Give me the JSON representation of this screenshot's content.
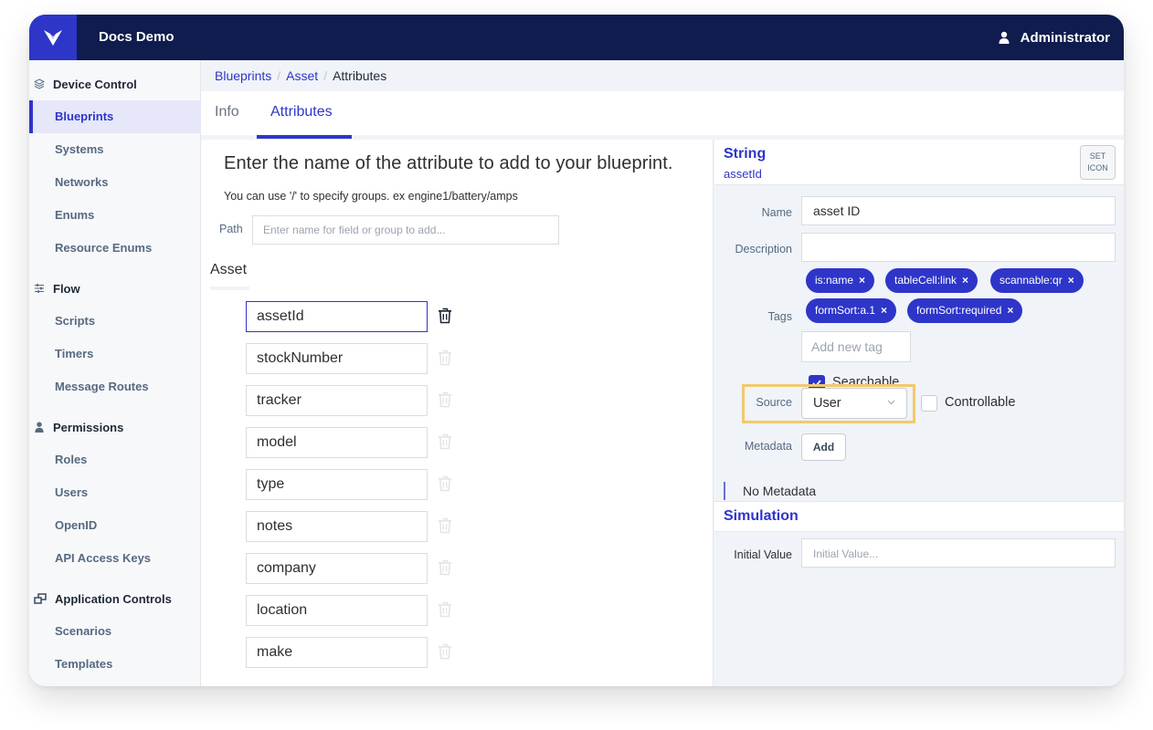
{
  "header": {
    "app_title": "Docs Demo",
    "user_name": "Administrator"
  },
  "sidebar": {
    "sections": [
      {
        "label": "Device Control",
        "icon": "layers-icon",
        "items": [
          {
            "label": "Blueprints",
            "active": true
          },
          {
            "label": "Systems"
          },
          {
            "label": "Networks"
          },
          {
            "label": "Enums"
          },
          {
            "label": "Resource Enums"
          }
        ]
      },
      {
        "label": "Flow",
        "icon": "sliders-icon",
        "items": [
          {
            "label": "Scripts"
          },
          {
            "label": "Timers"
          },
          {
            "label": "Message Routes"
          }
        ]
      },
      {
        "label": "Permissions",
        "icon": "user-icon",
        "items": [
          {
            "label": "Roles"
          },
          {
            "label": "Users"
          },
          {
            "label": "OpenID"
          },
          {
            "label": "API Access Keys"
          }
        ]
      },
      {
        "label": "Application Controls",
        "icon": "windows-icon",
        "items": [
          {
            "label": "Scenarios"
          },
          {
            "label": "Templates"
          }
        ]
      }
    ]
  },
  "breadcrumb": {
    "items": [
      "Blueprints",
      "Asset",
      "Attributes"
    ]
  },
  "tabs": [
    {
      "label": "Info",
      "active": false
    },
    {
      "label": "Attributes",
      "active": true
    }
  ],
  "attributes_pane": {
    "title": "Enter the name of the attribute to add to your blueprint.",
    "subtitle": "You can use '/' to specify groups. ex engine1/battery/amps",
    "path_label": "Path",
    "path_placeholder": "Enter name for field or group to add...",
    "path_value": "",
    "group_name": "Asset",
    "attributes": [
      {
        "value": "assetId",
        "focused": true
      },
      {
        "value": "stockNumber"
      },
      {
        "value": "tracker"
      },
      {
        "value": "model"
      },
      {
        "value": "type"
      },
      {
        "value": "notes"
      },
      {
        "value": "company"
      },
      {
        "value": "location"
      },
      {
        "value": "make"
      }
    ]
  },
  "detail": {
    "type": "String",
    "attribute_key": "assetId",
    "set_icon_label_line1": "SET",
    "set_icon_label_line2": "ICON",
    "name_label": "Name",
    "name_value": "asset ID",
    "description_label": "Description",
    "description_value": "",
    "tags_label": "Tags",
    "tags": [
      "is:name",
      "tableCell:link",
      "scannable:qr",
      "formSort:a.1",
      "formSort:required"
    ],
    "tag_remove_glyph": "×",
    "add_tag_placeholder": "Add new tag",
    "searchable_label": "Searchable",
    "searchable_checked": true,
    "source_label": "Source",
    "source_value": "User",
    "controllable_label": "Controllable",
    "controllable_checked": false,
    "metadata_label": "Metadata",
    "metadata_add_label": "Add",
    "no_metadata_text": "No Metadata",
    "simulation_title": "Simulation",
    "initial_value_label": "Initial Value",
    "initial_value_placeholder": "Initial Value...",
    "initial_value": ""
  },
  "colors": {
    "brand": "#2e35c9",
    "topbar": "#0f1c4d",
    "highlight_frame": "#f2c96b"
  }
}
